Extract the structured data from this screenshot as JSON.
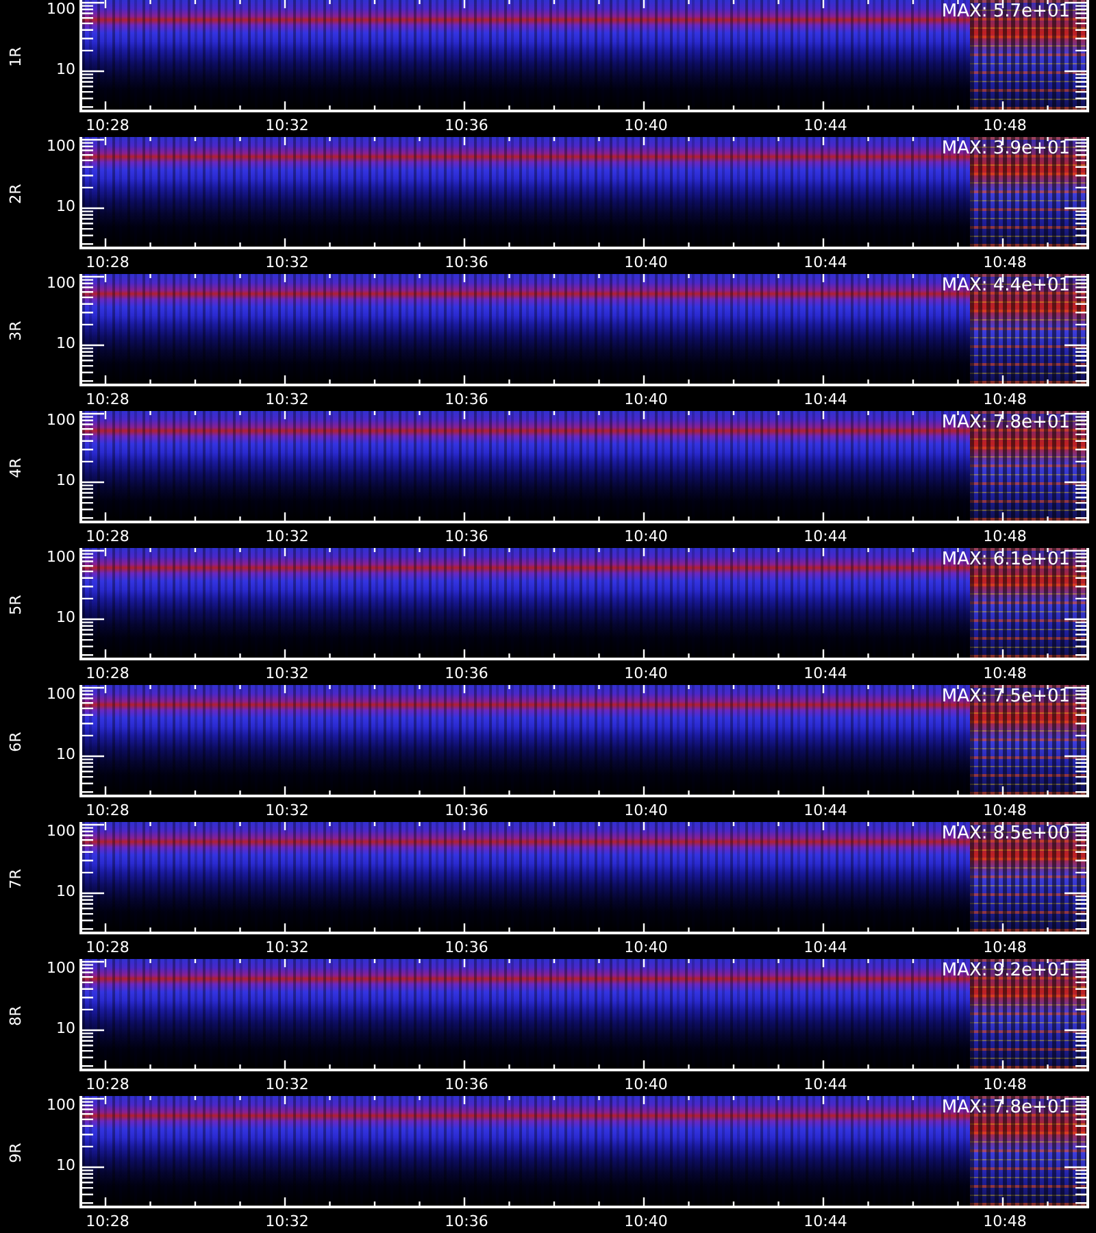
{
  "panels": [
    {
      "label": "1R",
      "max": "MAX: 5.7e+01",
      "y_ticks": [
        "100",
        "10"
      ],
      "x_ticks": [
        "10:28",
        "10:32",
        "10:36",
        "10:40",
        "10:44",
        "10:48"
      ]
    },
    {
      "label": "2R",
      "max": "MAX: 3.9e+01",
      "y_ticks": [
        "100",
        "10"
      ],
      "x_ticks": [
        "10:28",
        "10:32",
        "10:36",
        "10:40",
        "10:44",
        "10:48"
      ]
    },
    {
      "label": "3R",
      "max": "MAX: 4.4e+01",
      "y_ticks": [
        "100",
        "10"
      ],
      "x_ticks": [
        "10:28",
        "10:32",
        "10:36",
        "10:40",
        "10:44",
        "10:48"
      ]
    },
    {
      "label": "4R",
      "max": "MAX: 7.8e+01",
      "y_ticks": [
        "100",
        "10"
      ],
      "x_ticks": [
        "10:28",
        "10:32",
        "10:36",
        "10:40",
        "10:44",
        "10:48"
      ]
    },
    {
      "label": "5R",
      "max": "MAX: 6.1e+01",
      "y_ticks": [
        "100",
        "10"
      ],
      "x_ticks": [
        "10:28",
        "10:32",
        "10:36",
        "10:40",
        "10:44",
        "10:48"
      ]
    },
    {
      "label": "6R",
      "max": "MAX: 7.5e+01",
      "y_ticks": [
        "100",
        "10"
      ],
      "x_ticks": [
        "10:28",
        "10:32",
        "10:36",
        "10:40",
        "10:44",
        "10:48"
      ]
    },
    {
      "label": "7R",
      "max": "MAX: 8.5e+00",
      "y_ticks": [
        "100",
        "10"
      ],
      "x_ticks": [
        "10:28",
        "10:32",
        "10:36",
        "10:40",
        "10:44",
        "10:48"
      ]
    },
    {
      "label": "8R",
      "max": "MAX: 9.2e+01",
      "y_ticks": [
        "100",
        "10"
      ],
      "x_ticks": [
        "10:28",
        "10:32",
        "10:36",
        "10:40",
        "10:44",
        "10:48"
      ]
    },
    {
      "label": "9R",
      "max": "MAX: 7.8e+01",
      "y_ticks": [
        "100",
        "10"
      ],
      "x_ticks": [
        "10:28",
        "10:32",
        "10:36",
        "10:40",
        "10:44",
        "10:48"
      ]
    }
  ]
}
